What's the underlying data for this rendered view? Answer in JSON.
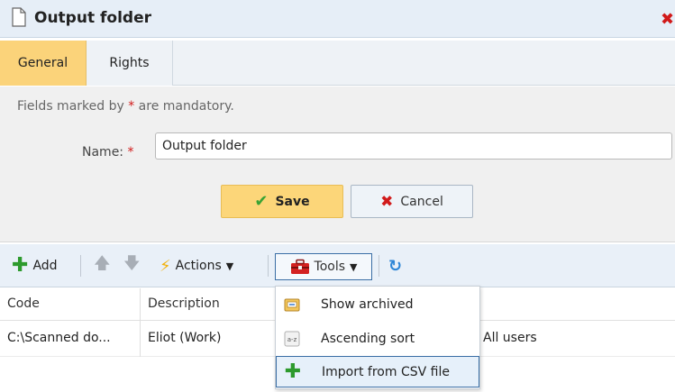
{
  "window": {
    "title": "Output folder"
  },
  "tabs": [
    {
      "label": "General",
      "active": true
    },
    {
      "label": "Rights",
      "active": false
    }
  ],
  "form": {
    "mandatory_note_pre": "Fields marked by ",
    "mandatory_star": "*",
    "mandatory_note_post": " are mandatory.",
    "name_label": "Name:",
    "name_star": "*",
    "name_value": "Output folder",
    "save_label": "Save",
    "cancel_label": "Cancel"
  },
  "toolbar": {
    "add_label": "Add",
    "actions_label": "Actions",
    "tools_label": "Tools"
  },
  "grid": {
    "columns": [
      "Code",
      "Description"
    ],
    "rows": [
      {
        "code": "C:\\Scanned do...",
        "description": "Eliot (Work)",
        "extra": "All users"
      }
    ]
  },
  "tools_menu": {
    "items": [
      {
        "label": "Show archived",
        "icon": "archive-icon"
      },
      {
        "label": "Ascending sort",
        "icon": "sort-az-icon"
      },
      {
        "label": "Import from CSV file",
        "icon": "plus-icon",
        "highlighted": true
      }
    ]
  },
  "colors": {
    "active_tab": "#fbd37a",
    "save_button": "#fcd679",
    "close_red": "#d11a1a",
    "add_green": "#2d9a2d",
    "toolbar_bg": "#e9f0f8"
  }
}
